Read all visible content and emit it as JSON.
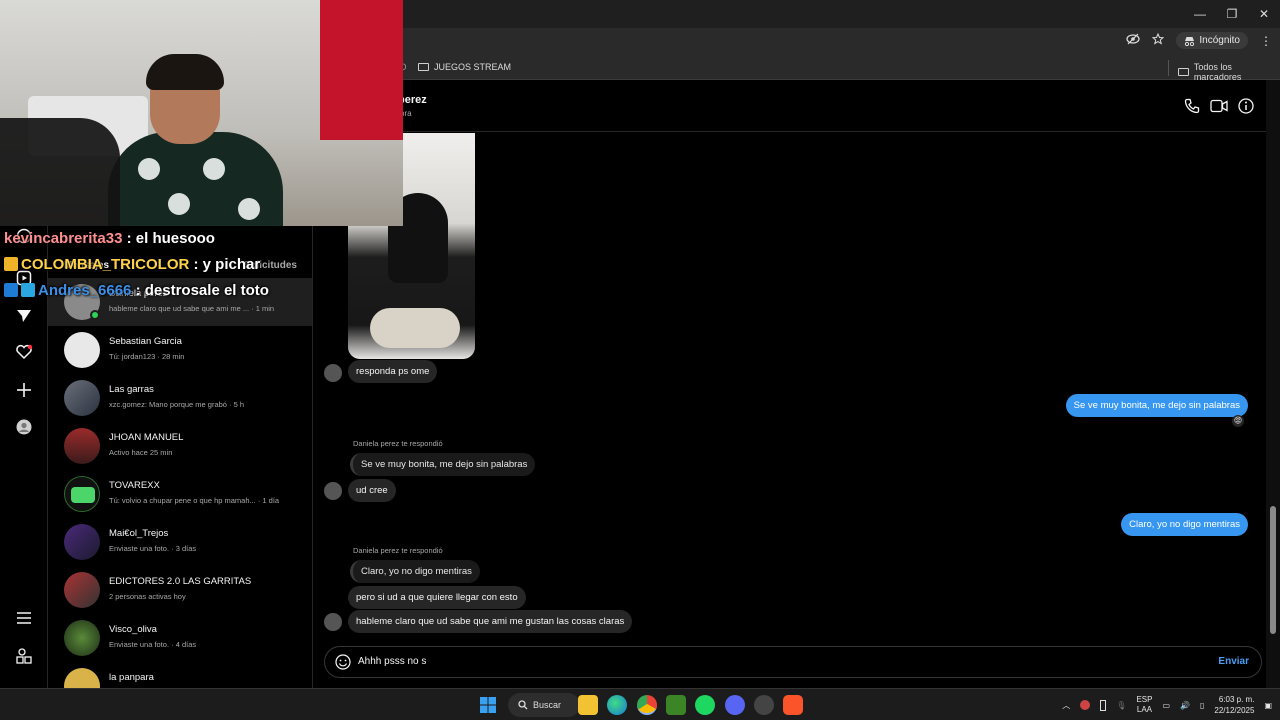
{
  "browser": {
    "window_controls": [
      "—",
      "❐",
      "✕"
    ],
    "incognito_label": "Incógnito",
    "bookmark_folder": "JUEGOS STREAM",
    "bookmarks_all": "Todos los marcadores"
  },
  "overlay_chat": [
    {
      "user": "kevincabrerita33",
      "msg": "el huesooo",
      "color": "#ff8f8f"
    },
    {
      "user": "COLOMBIA_TRICOLOR",
      "msg": "y pichar",
      "color": "#ffd24a"
    },
    {
      "user": "Andres_6666",
      "msg": "destrosale el toto",
      "color": "#3d8fe8"
    }
  ],
  "inbox": {
    "heading": "Mensajes",
    "requests": "Solicitudes",
    "conversations": [
      {
        "name": "Daniela perez",
        "preview": "hableme claro que ud sabe que ami me ... · 1 min",
        "online": true
      },
      {
        "name": "Sebastian Garcia",
        "preview": "Tú: jordan123 · 28 min"
      },
      {
        "name": "Las garras",
        "preview": "xzc.gomez: Mano porque me grabó · 5 h"
      },
      {
        "name": "JHOAN MANUEL",
        "preview": "Activo hace 25 min"
      },
      {
        "name": "TOVAREXX",
        "preview": "Tú: volvio a chupar pene o que hp mamah... · 1 día"
      },
      {
        "name": "Mai€ol_Trejos",
        "preview": "Enviaste una foto. · 3 días"
      },
      {
        "name": "EDICTORES 2.0 LAS GARRITAS",
        "preview": "2 personas activas hoy"
      },
      {
        "name": "Visco_oliva",
        "preview": "Enviaste una foto. · 4 días"
      },
      {
        "name": "la panpara",
        "preview": ""
      }
    ]
  },
  "chat": {
    "header_name": "perez",
    "header_status": "ora",
    "messages": {
      "m1": "responda ps ome",
      "m2": "Se ve muy bonita, me dejo sin palabras",
      "reply_label_1": "Daniela perez te respondió",
      "quoted_1": "Se ve muy bonita, me dejo sin palabras",
      "m3": "ud cree",
      "m4": "Claro, yo no digo mentiras",
      "reply_label_2": "Daniela perez te respondió",
      "quoted_2": "Claro, yo no digo mentiras",
      "m5": "pero si ud a que quiere llegar con esto",
      "m6": "hableme claro que ud sabe que ami me gustan las cosas claras"
    },
    "composer_value": "Ahhh psss no s",
    "send_label": "Enviar"
  },
  "taskbar": {
    "search_label": "Buscar",
    "lang_top": "ESP",
    "lang_bottom": "LAA",
    "time": "6:03 p. m.",
    "date": "22/12/2025"
  },
  "colors": {
    "accent": "#3797f0",
    "incoming": "#262626",
    "background": "#000000"
  }
}
